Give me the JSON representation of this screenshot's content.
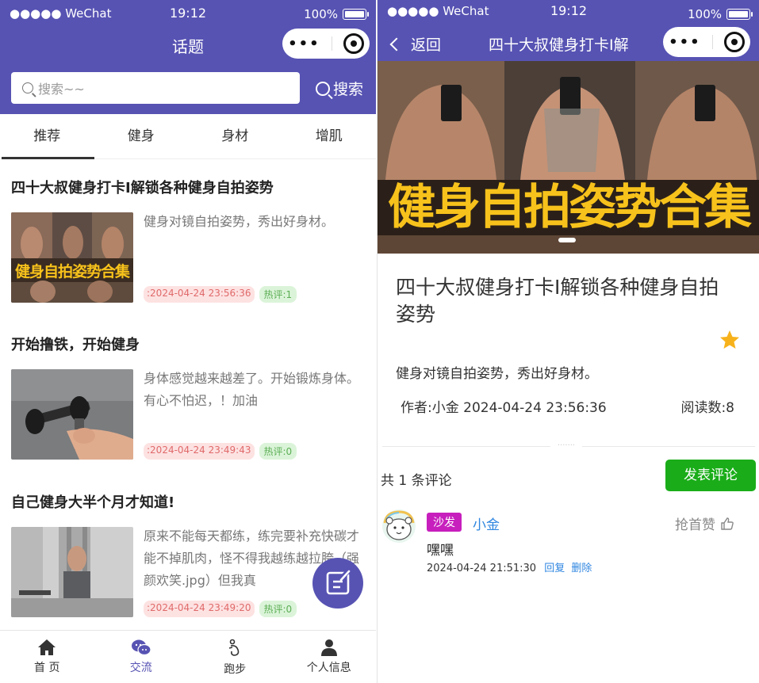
{
  "status": {
    "carrier": "●●●●● WeChat",
    "time": "19:12",
    "battery": "100%"
  },
  "left": {
    "nav_title": "话题",
    "search": {
      "placeholder": "搜索~~",
      "button": "搜索"
    },
    "tabs": [
      "推荐",
      "健身",
      "身材",
      "增肌"
    ],
    "posts": [
      {
        "title": "四十大叔健身打卡Ⅰ解锁各种健身自拍姿势",
        "desc": "健身对镜自拍姿势，秀出好身材。",
        "time": ":2024-04-24 23:56:36",
        "hot": "热评:1",
        "thumb_text": "健身自拍姿势合集"
      },
      {
        "title": "开始撸铁，开始健身",
        "desc": "身体感觉越来越差了。开始锻炼身体。有心不怕迟，！加油",
        "time": ":2024-04-24 23:49:43",
        "hot": "热评:0"
      },
      {
        "title": "自己健身大半个月才知道!",
        "desc": "原来不能每天都练，练完要补充快碳才能不掉肌肉，怪不得我越练越拉胯（强颜欢笑.jpg）但我真",
        "time": ":2024-04-24 23:49:20",
        "hot": "热评:0"
      }
    ],
    "bottom_nav": [
      {
        "label": "首 页",
        "icon": "home-icon"
      },
      {
        "label": "交流",
        "icon": "wechat-icon",
        "active": true
      },
      {
        "label": "跑步",
        "icon": "running-icon"
      },
      {
        "label": "个人信息",
        "icon": "person-icon"
      }
    ]
  },
  "right": {
    "back_label": "返回",
    "nav_title": "四十大叔健身打卡Ⅰ解",
    "banner_text": "健身自拍姿势合集",
    "title": "四十大叔健身打卡Ⅰ解锁各种健身自拍姿势",
    "content": "健身对镜自拍姿势，秀出好身材。",
    "meta": "作者:小金 2024-04-24 23:56:36",
    "read_count": "阅读数:8",
    "comment_count": "共 1 条评论",
    "post_comment_button": "发表评论",
    "comments": [
      {
        "badge": "沙发",
        "user": "小金",
        "like_label": "抢首赞",
        "text": "嘿嘿",
        "time": "2024-04-24 21:51:30",
        "reply": "回复",
        "delete": "删除"
      }
    ]
  },
  "colors": {
    "primary": "#5753b3",
    "green": "#1aad19",
    "link": "#2f86e0",
    "badge": "#c71fbd",
    "star": "#f7b21b"
  }
}
